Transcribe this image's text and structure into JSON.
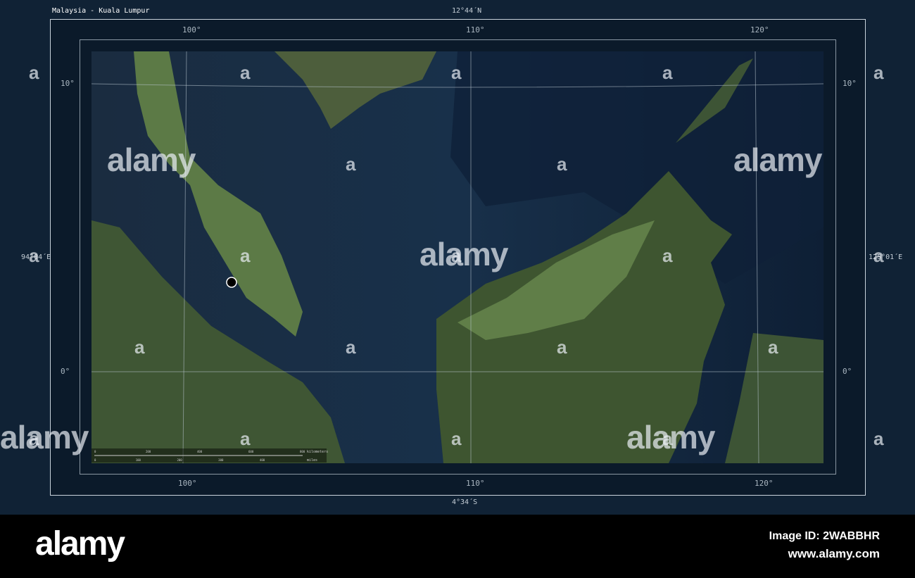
{
  "title": "Malaysia - Kuala Lumpur",
  "bounds": {
    "north": "12°44´N",
    "south": "4°34´S",
    "west": "94°04´E",
    "east": "125°01´E"
  },
  "graticule": {
    "longitudes": [
      "100°",
      "110°",
      "120°"
    ],
    "latitudes": [
      "10°",
      "0°"
    ]
  },
  "marker": {
    "name": "Kuala Lumpur",
    "lon": 101.69,
    "lat": 3.14
  },
  "scale_bar": {
    "km_label": "kilometers",
    "km_ticks": [
      "0",
      "200",
      "400",
      "600",
      "800"
    ],
    "mi_label": "miles",
    "mi_ticks": [
      "0",
      "100",
      "200",
      "300",
      "400"
    ]
  },
  "watermark": "alamy",
  "banner": {
    "logo": "alamy",
    "image_id": "Image ID: 2WABBHR",
    "url": "www.alamy.com"
  },
  "colors": {
    "sea": "#14263a",
    "deep_sea": "#0c1a2c",
    "land": "#46603a",
    "frame_bg": "#102235"
  }
}
